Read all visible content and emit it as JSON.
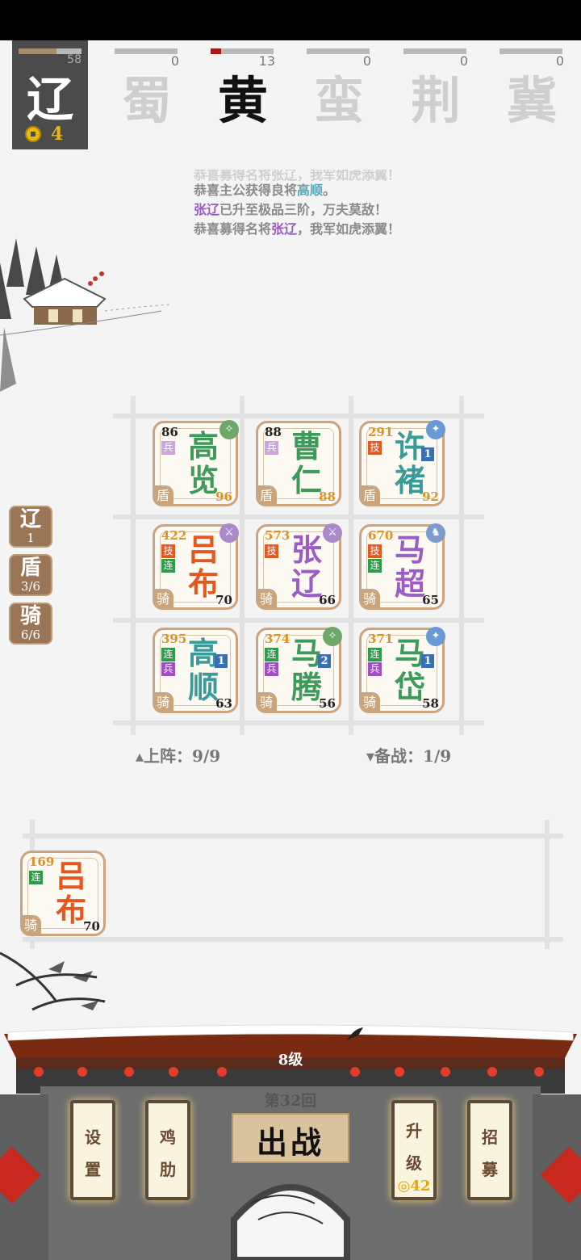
{
  "top_factions": {
    "own": {
      "name": "辽",
      "score": "58",
      "gold": "4",
      "progress": 0.6
    },
    "others": [
      {
        "name": "蜀",
        "score": "0",
        "active": false
      },
      {
        "name": "黄",
        "score": "13",
        "active": true
      },
      {
        "name": "蛮",
        "score": "0",
        "active": false
      },
      {
        "name": "荆",
        "score": "0",
        "active": false
      },
      {
        "name": "冀",
        "score": "0",
        "active": false
      }
    ]
  },
  "news": {
    "faded": "恭喜募得名将张辽，我军如虎添翼！",
    "l1a": "恭喜主公获得良将",
    "l1b": "高顺",
    "l1c": "。",
    "l2a": "张辽",
    "l2b": "已升至极品三阶，万夫莫敌！",
    "l3a": "恭喜募得名将",
    "l3b": "张辽",
    "l3c": "，我军如虎添翼！"
  },
  "side_tabs": [
    {
      "title": "辽",
      "count": "1"
    },
    {
      "title": "盾",
      "count": "3/6"
    },
    {
      "title": "骑",
      "count": "6/6"
    }
  ],
  "grid": [
    {
      "name": "高览",
      "lv": "86",
      "power": "96",
      "type": "盾",
      "tags": [
        "兵"
      ],
      "badge": "spear-icon",
      "name_color": "#3e9a58"
    },
    {
      "name": "曹仁",
      "lv": "88",
      "power": "88",
      "type": "盾",
      "tags": [
        "兵"
      ],
      "badge": "",
      "name_color": "#3e9a58"
    },
    {
      "name": "许褚",
      "lv": "291",
      "power": "92",
      "type": "盾",
      "tags": [
        "技"
      ],
      "badge": "boot-icon",
      "num": "1",
      "name_color": "#3a9a9a"
    },
    {
      "name": "吕布",
      "lv": "422",
      "power": "70",
      "type": "骑",
      "tags": [
        "技",
        "连"
      ],
      "badge": "sword-icon",
      "name_color": "#e4571f"
    },
    {
      "name": "张辽",
      "lv": "573",
      "power": "66",
      "type": "骑",
      "tags": [
        "技"
      ],
      "badge": "sword-icon",
      "name_color": "#9b5cc4"
    },
    {
      "name": "马超",
      "lv": "670",
      "power": "65",
      "type": "骑",
      "tags": [
        "技",
        "连"
      ],
      "badge": "horse-icon",
      "name_color": "#9b5cc4"
    },
    {
      "name": "高顺",
      "lv": "395",
      "power": "63",
      "type": "骑",
      "tags": [
        "连",
        "兵"
      ],
      "badge": "",
      "num": "1",
      "name_color": "#3a9a9a"
    },
    {
      "name": "马腾",
      "lv": "374",
      "power": "56",
      "type": "骑",
      "tags": [
        "连",
        "兵"
      ],
      "badge": "spear-icon",
      "num": "2",
      "name_color": "#3e9a58"
    },
    {
      "name": "马岱",
      "lv": "371",
      "power": "58",
      "type": "骑",
      "tags": [
        "连",
        "兵"
      ],
      "badge": "boot-icon",
      "num": "1",
      "name_color": "#3e9a58"
    }
  ],
  "counts": {
    "on": "▴上阵：9/9",
    "bk": "▾备战：1/9"
  },
  "bench": [
    {
      "name": "吕布",
      "lv": "169",
      "power": "70",
      "type": "骑",
      "tags": [
        "连"
      ],
      "name_color": "#e4571f"
    }
  ],
  "bottom": {
    "level": "8级",
    "round": "第32回",
    "battle": "出战",
    "settings": [
      "设",
      "置"
    ],
    "rib": [
      "鸡",
      "肋"
    ],
    "upgrade": [
      "升",
      "级"
    ],
    "upgrade_cost": "42",
    "recruit": [
      "招",
      "募"
    ]
  }
}
